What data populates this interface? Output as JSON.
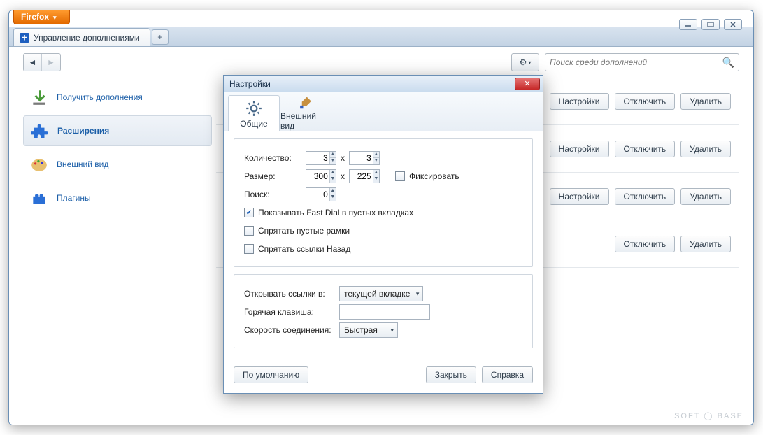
{
  "app_button": "Firefox",
  "tab_title": "Управление дополнениями",
  "search": {
    "placeholder": "Поиск среди дополнений"
  },
  "sidebar": {
    "items": [
      {
        "label": "Получить дополнения"
      },
      {
        "label": "Расширения"
      },
      {
        "label": "Внешний вид"
      },
      {
        "label": "Плагины"
      }
    ]
  },
  "buttons": {
    "settings": "Настройки",
    "disable": "Отключить",
    "remove": "Удалить"
  },
  "dialog": {
    "title": "Настройки",
    "tabs": {
      "general": "Общие",
      "appearance": "Внешний вид"
    },
    "labels": {
      "quantity": "Количество:",
      "size": "Размер:",
      "search": "Поиск:",
      "x": "x",
      "fix": "Фиксировать",
      "show_fd": "Показывать Fast Dial в пустых вкладках",
      "hide_empty": "Спрятать пустые рамки",
      "hide_back": "Спрятать ссылки Назад",
      "open_links": "Открывать ссылки в:",
      "hotkey": "Горячая клавиша:",
      "conn_speed": "Скорость соединения:"
    },
    "values": {
      "cols": "3",
      "rows": "3",
      "width": "300",
      "height": "225",
      "search_val": "0",
      "show_fd_checked": true,
      "hide_empty_checked": false,
      "hide_back_checked": false,
      "open_links_sel": "текущей вкладке",
      "hotkey_val": "",
      "conn_speed_sel": "Быстрая"
    },
    "footer": {
      "defaults": "По умолчанию",
      "close": "Закрыть",
      "help": "Справка"
    }
  },
  "watermark": "SOFT ◯ BASE"
}
